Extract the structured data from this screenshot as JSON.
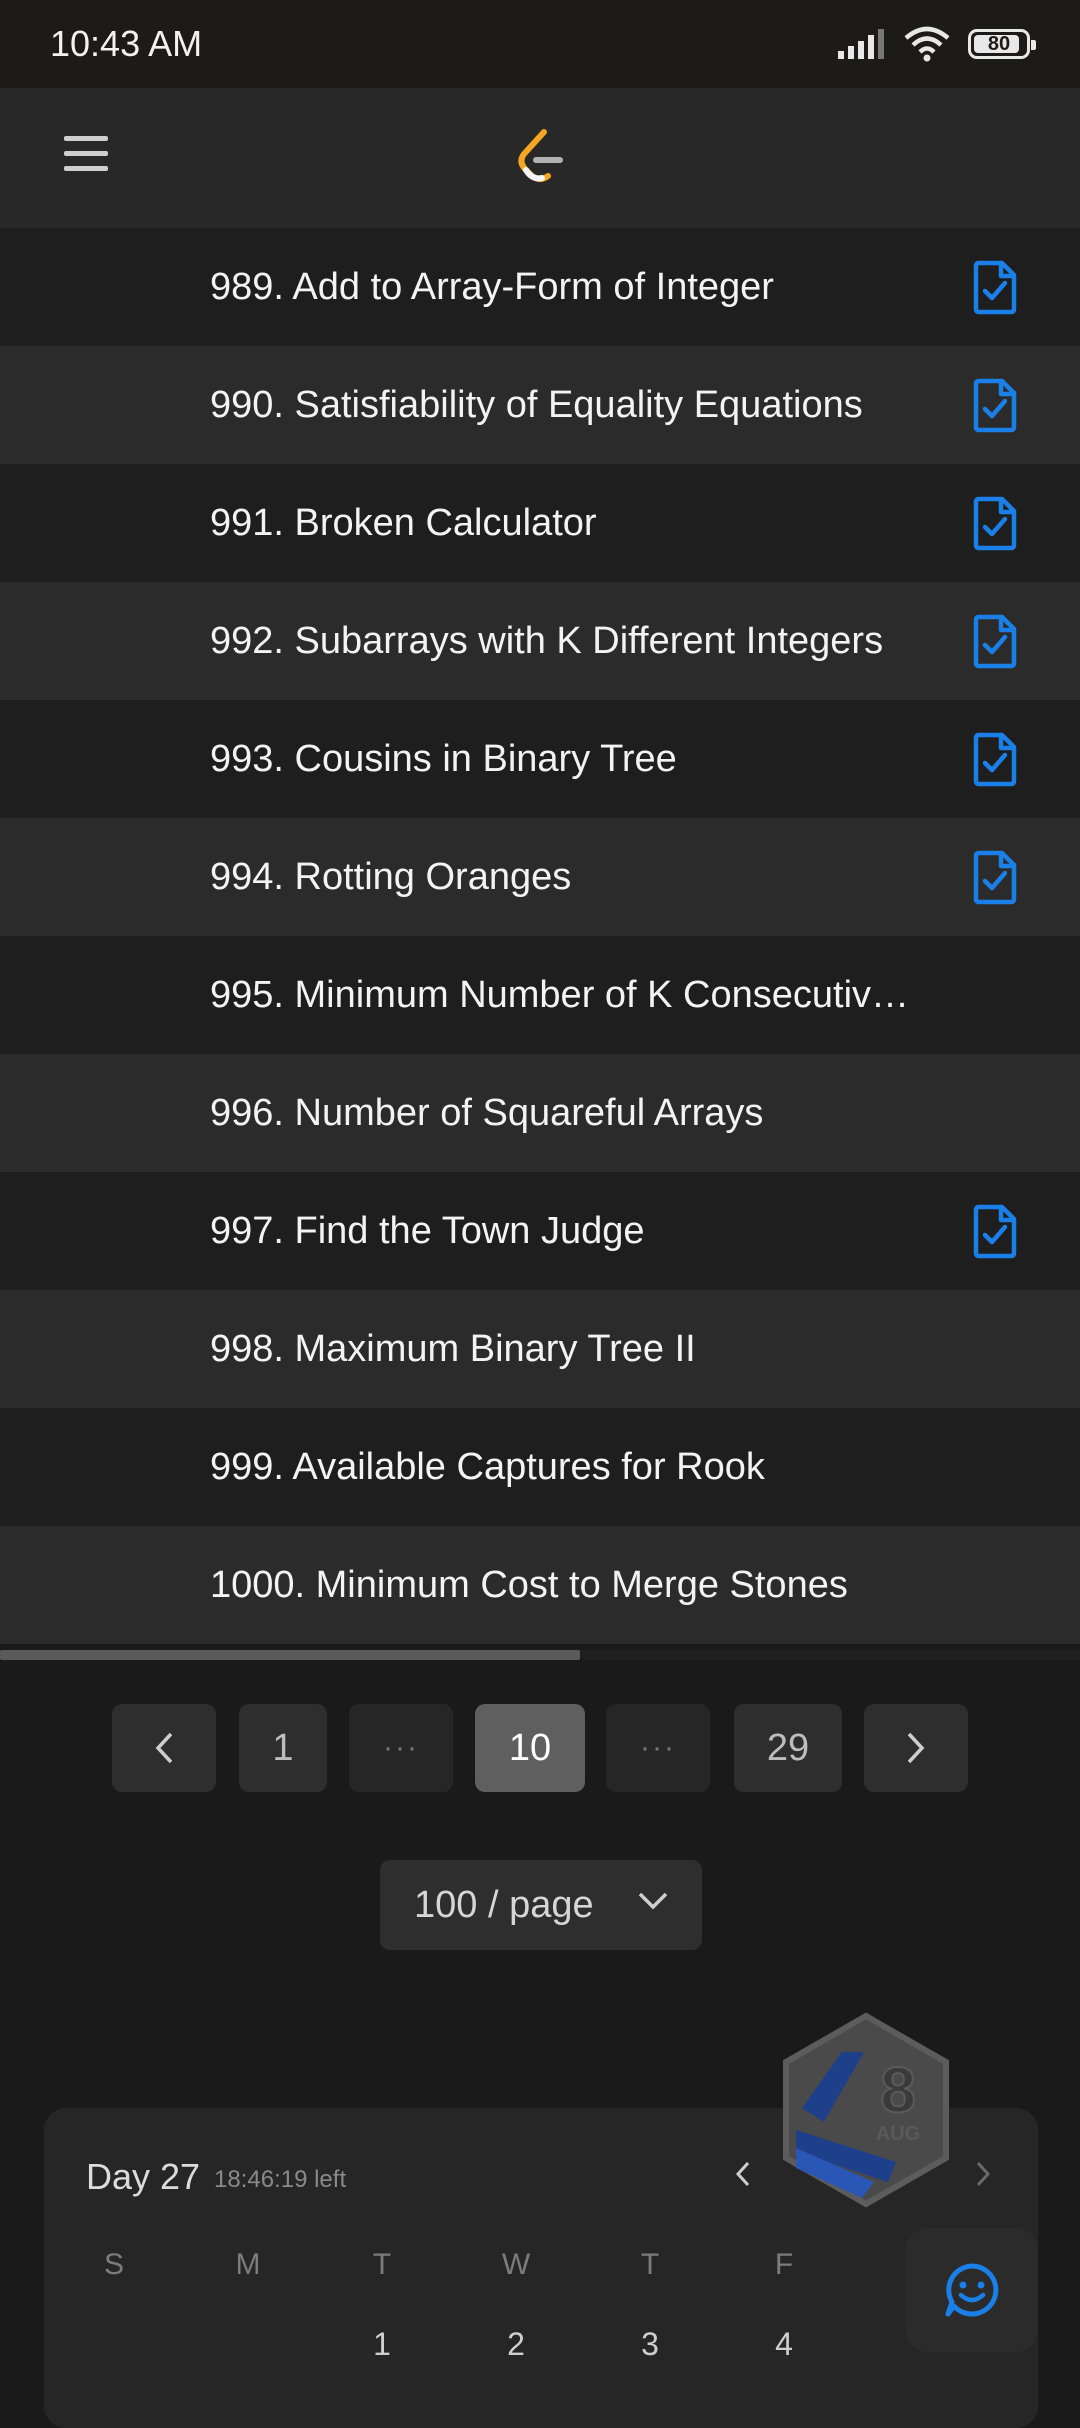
{
  "status_bar": {
    "time": "10:43 AM",
    "battery": "80"
  },
  "header": {
    "logo_icon": "leetcode-logo-icon",
    "menu_icon": "hamburger-menu-icon"
  },
  "problems": [
    {
      "title": "989. Add to Array-Form of Integer",
      "solved": true
    },
    {
      "title": "990. Satisfiability of Equality Equations",
      "solved": true
    },
    {
      "title": "991. Broken Calculator",
      "solved": true
    },
    {
      "title": "992. Subarrays with K Different Integers",
      "solved": true
    },
    {
      "title": "993. Cousins in Binary Tree",
      "solved": true
    },
    {
      "title": "994. Rotting Oranges",
      "solved": true
    },
    {
      "title": "995. Minimum Number of K Consecutiv…",
      "solved": false
    },
    {
      "title": "996. Number of Squareful Arrays",
      "solved": false
    },
    {
      "title": "997. Find the Town Judge",
      "solved": true
    },
    {
      "title": "998. Maximum Binary Tree II",
      "solved": false
    },
    {
      "title": "999. Available Captures for Rook",
      "solved": false
    },
    {
      "title": "1000. Minimum Cost to Merge Stones",
      "solved": false
    }
  ],
  "pagination": {
    "first": "1",
    "ellipsis": "···",
    "current": "10",
    "last": "29"
  },
  "page_size": {
    "label": "100 / page"
  },
  "calendar": {
    "day_label": "Day 27",
    "time_left": "18:46:19 left",
    "weekdays": [
      "S",
      "M",
      "T",
      "W",
      "T",
      "F"
    ],
    "dates": [
      "1",
      "2",
      "3",
      "4"
    ]
  },
  "badge": {
    "day": "8",
    "month": "AUG"
  },
  "colors": {
    "accent_blue": "#1a7fe6",
    "logo_orange": "#f5a623"
  }
}
